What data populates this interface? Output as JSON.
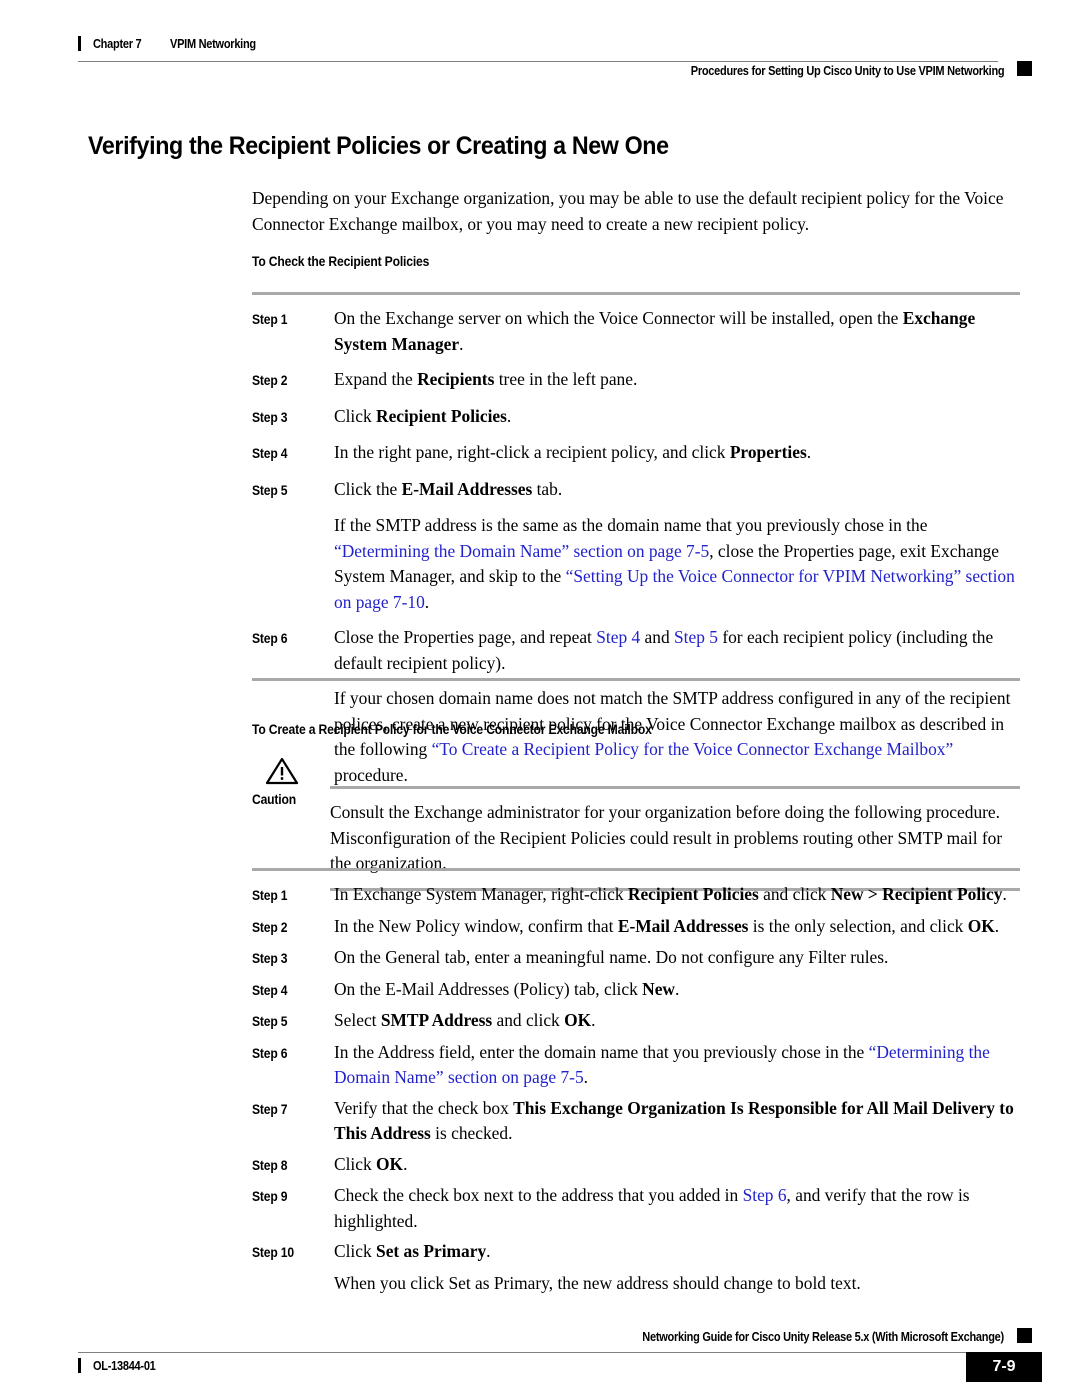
{
  "header": {
    "chapter": "Chapter 7",
    "chapter_title": "VPIM Networking",
    "running_head": "Procedures for Setting Up Cisco Unity to Use VPIM Networking"
  },
  "section": {
    "title": "Verifying the Recipient Policies or Creating a New One",
    "intro": "Depending on your Exchange organization, you may be able to use the default recipient policy for the Voice Connector Exchange mailbox, or you may need to create a new recipient policy."
  },
  "procedure_one": {
    "heading": "To Check the Recipient Policies",
    "steps": [
      {
        "label": "Step 1"
      },
      {
        "label": "Step 2"
      },
      {
        "label": "Step 3"
      },
      {
        "label": "Step 4"
      },
      {
        "label": "Step 5"
      },
      {
        "label": "Step 6"
      }
    ],
    "step1_text_a": "On the Exchange server on which the Voice Connector will be installed, open the ",
    "step1_bold": "Exchange System Manager",
    "step1_text_b": ".",
    "step2_text_a": "Expand the ",
    "step2_bold": "Recipients",
    "step2_text_b": " tree in the left pane.",
    "step3_text_a": "Click ",
    "step3_bold": "Recipient Policies",
    "step3_text_b": ".",
    "step4_text_a": "In the right pane, right-click a recipient policy, and click ",
    "step4_bold": "Properties",
    "step4_text_b": ".",
    "step5_text_a": "Click the ",
    "step5_bold": "E-Mail Addresses",
    "step5_text_b": " tab.",
    "note_a": "If the SMTP address is the same as the domain name that you previously chose in the ",
    "note_link1": "“Determining the Domain Name” section on page 7-5",
    "note_b": ", close the Properties page, exit Exchange System Manager, and skip to the ",
    "note_link2": "“Setting Up the Voice Connector for VPIM Networking” section on page 7-10",
    "note_c": ".",
    "step6_text_a": "Close the Properties page, and repeat ",
    "step6_link1": "Step 4",
    "step6_text_b": " and ",
    "step6_link2": "Step 5",
    "step6_text_c": " for each recipient policy (including the default recipient policy).",
    "closing_a": "If your chosen domain name does not match the SMTP address configured in any of the recipient polices, create a new recipient policy for the Voice Connector Exchange mailbox as described in the following ",
    "closing_link": "“To Create a Recipient Policy for the Voice Connector Exchange Mailbox”",
    "closing_b": " procedure."
  },
  "procedure_two": {
    "heading": "To Create a Recipient Policy for the Voice Connector Exchange Mailbox",
    "caution_label": "Caution",
    "caution_icon": "warning-triangle-icon",
    "caution_text": "Consult the Exchange administrator for your organization before doing the following procedure. Misconfiguration of the Recipient Policies could result in problems routing other SMTP mail for the organization.",
    "steps": [
      {
        "label": "Step 1"
      },
      {
        "label": "Step 2"
      },
      {
        "label": "Step 3"
      },
      {
        "label": "Step 4"
      },
      {
        "label": "Step 5"
      },
      {
        "label": "Step 6"
      },
      {
        "label": "Step 7"
      },
      {
        "label": "Step 8"
      },
      {
        "label": "Step 9"
      },
      {
        "label": "Step 10"
      }
    ],
    "step1_text_a": "In Exchange System Manager, right-click ",
    "step1_bold1": "Recipient Policies",
    "step1_text_b": " and click ",
    "step1_bold2": "New > Recipient Policy",
    "step1_text_c": ".",
    "step2_text_a": "In the New Policy window, confirm that ",
    "step2_bold1": "E-Mail Addresses",
    "step2_text_b": " is the only selection, and click ",
    "step2_bold2": "OK",
    "step2_text_c": ".",
    "step3_text": "On the General tab, enter a meaningful name. Do not configure any Filter rules.",
    "step4_text_a": "On the E-Mail Addresses (Policy) tab, click ",
    "step4_bold": "New",
    "step4_text_b": ".",
    "step5_text_a": "Select ",
    "step5_bold1": "SMTP Address",
    "step5_text_b": " and click ",
    "step5_bold2": "OK",
    "step5_text_c": ".",
    "step6_text_a": "In the Address field, enter the domain name that you previously chose in the ",
    "step6_link": "“Determining the Domain Name” section on page 7-5",
    "step6_text_b": ".",
    "step7_text_a": "Verify that the check box ",
    "step7_bold": "This Exchange Organization Is Responsible for All Mail Delivery to This Address",
    "step7_text_b": " is checked.",
    "step8_text_a": "Click ",
    "step8_bold": "OK",
    "step8_text_b": ".",
    "step9_text_a": "Check the check box next to the address that you added in ",
    "step9_link": "Step 6",
    "step9_text_b": ", and verify that the row is highlighted.",
    "step10_text_a": "Click ",
    "step10_bold": "Set as Primary",
    "step10_text_b": ".",
    "closing": "When you click Set as Primary, the new address should change to bold text."
  },
  "footer": {
    "doc_id": "OL-13844-01",
    "guide_title": "Networking Guide for Cisco Unity Release 5.x (With Microsoft Exchange)",
    "page_number": "7-9"
  },
  "colors": {
    "xref": "#2222cc",
    "rule": "#a9a9a9",
    "thin_rule": "#808080"
  }
}
